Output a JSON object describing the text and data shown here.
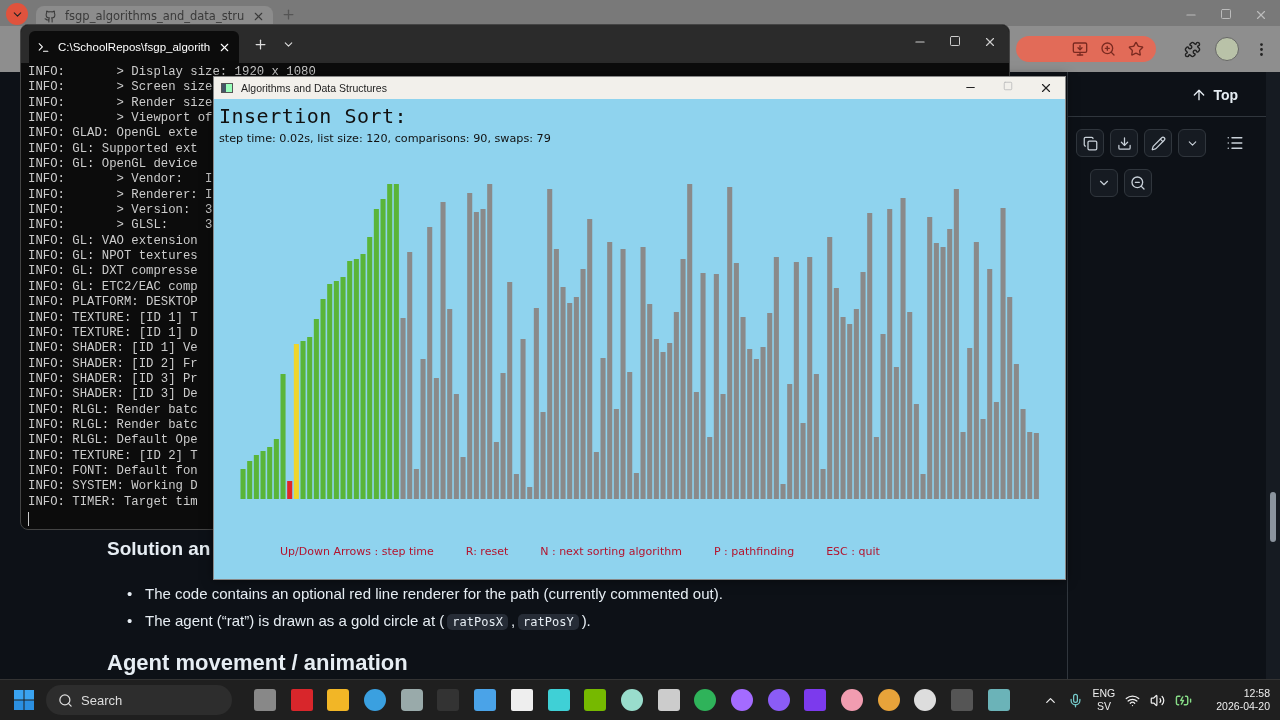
{
  "browser": {
    "tab_title": "fsgp_algorithms_and_data_stru",
    "top_button": "Top",
    "content": {
      "partial_heading": "Solution an",
      "bullets": [
        {
          "marker": "•",
          "parts": [
            {
              "kind": "text",
              "text": "The code contains an optional red line renderer for the path (currently commented out)."
            }
          ]
        },
        {
          "marker": "•",
          "parts": [
            {
              "kind": "text",
              "text": "The agent (“rat”) is drawn as a gold circle at ("
            },
            {
              "kind": "code",
              "text": "ratPosX"
            },
            {
              "kind": "text",
              "text": ","
            },
            {
              "kind": "code",
              "text": "ratPosY"
            },
            {
              "kind": "text",
              "text": ")."
            }
          ]
        }
      ],
      "heading": "Agent movement / animation"
    }
  },
  "terminal": {
    "tab_title": "C:\\SchoolRepos\\fsgp_algorith",
    "lines": [
      "INFO:       > Display size: 1920 x 1080",
      "INFO:       > Screen size",
      "INFO:       > Render size",
      "INFO:       > Viewport of",
      "INFO: GLAD: OpenGL exte",
      "INFO: GL: Supported ext",
      "INFO: GL: OpenGL device",
      "INFO:       > Vendor:   I",
      "INFO:       > Renderer: I",
      "INFO:       > Version:  3",
      "INFO:       > GLSL:     3",
      "INFO: GL: VAO extension",
      "INFO: GL: NPOT textures",
      "INFO: GL: DXT compresse",
      "INFO: GL: ETC2/EAC comp",
      "INFO: PLATFORM: DESKTOP",
      "INFO: TEXTURE: [ID 1] T",
      "INFO: TEXTURE: [ID 1] D",
      "INFO: SHADER: [ID 1] Ve",
      "INFO: SHADER: [ID 2] Fr",
      "INFO: SHADER: [ID 3] Pr",
      "INFO: SHADER: [ID 3] De",
      "INFO: RLGL: Render batc",
      "INFO: RLGL: Render batc",
      "INFO: RLGL: Default Ope",
      "INFO: TEXTURE: [ID 2] T",
      "INFO: FONT: Default fon",
      "INFO: SYSTEM: Working D",
      "INFO: TIMER: Target tim"
    ]
  },
  "app": {
    "title": "Algorithms and Data Structures",
    "heading": "Insertion Sort:",
    "stats": "step time: 0.02s, list size: 120, comparisons: 90, swaps: 79",
    "hints": [
      "Up/Down Arrows : step time",
      "R: reset",
      "N : next sorting algorithm",
      "P : pathfinding",
      "ESC : quit"
    ]
  },
  "taskbar": {
    "search": "Search",
    "language": "ENG",
    "layout": "SV",
    "time": "12:58",
    "date": "2026-04-20"
  }
}
